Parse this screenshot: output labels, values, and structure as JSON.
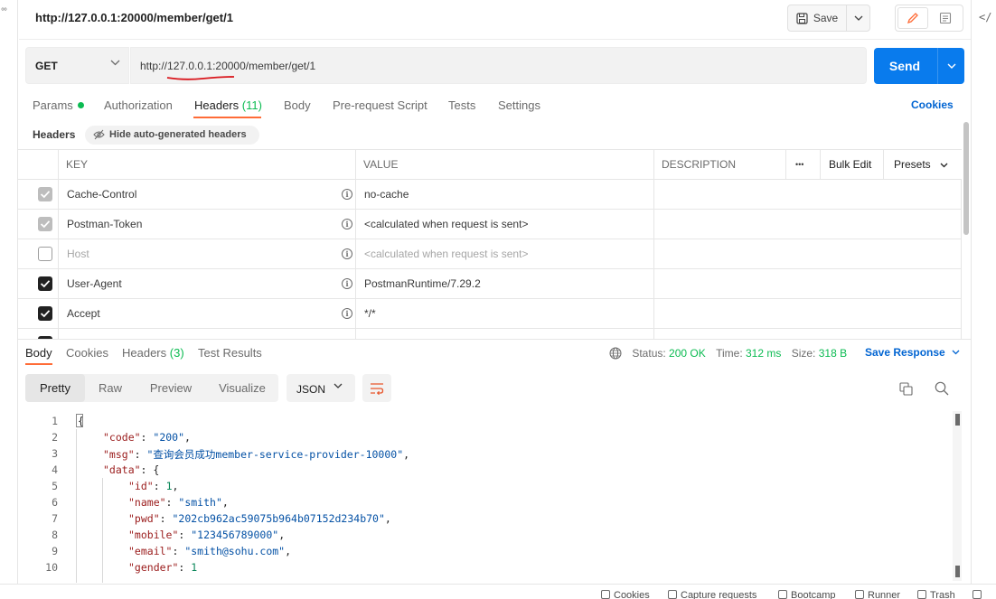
{
  "tab": {
    "title": "http://127.0.0.1:20000/member/get/1"
  },
  "toolbar": {
    "save_label": "Save"
  },
  "request": {
    "method": "GET",
    "url": "http://127.0.0.1:20000/member/get/1",
    "send_label": "Send"
  },
  "request_tabs": {
    "params": "Params",
    "authorization": "Authorization",
    "headers": "Headers",
    "headers_count": "(11)",
    "body": "Body",
    "prerequest": "Pre-request Script",
    "tests": "Tests",
    "settings": "Settings",
    "cookies": "Cookies"
  },
  "headers_section": {
    "label": "Headers",
    "hide_auto": "Hide auto-generated headers",
    "columns": {
      "key": "KEY",
      "value": "VALUE",
      "description": "DESCRIPTION",
      "more": "•••",
      "bulk_edit": "Bulk Edit",
      "presets": "Presets"
    },
    "rows": [
      {
        "key": "Cache-Control",
        "value": "no-cache",
        "state": "disabled-checked"
      },
      {
        "key": "Postman-Token",
        "value": "<calculated when request is sent>",
        "state": "disabled-checked"
      },
      {
        "key": "Host",
        "value": "<calculated when request is sent>",
        "state": "unchecked"
      },
      {
        "key": "User-Agent",
        "value": "PostmanRuntime/7.29.2",
        "state": "checked"
      },
      {
        "key": "Accept",
        "value": "*/*",
        "state": "checked"
      }
    ]
  },
  "response": {
    "tabs": {
      "body": "Body",
      "cookies": "Cookies",
      "headers": "Headers",
      "headers_count": "(3)",
      "test_results": "Test Results"
    },
    "status_label": "Status:",
    "status_value": "200 OK",
    "time_label": "Time:",
    "time_value": "312 ms",
    "size_label": "Size:",
    "size_value": "318 B",
    "save_response": "Save Response",
    "views": {
      "pretty": "Pretty",
      "raw": "Raw",
      "preview": "Preview",
      "visualize": "Visualize"
    },
    "format": "JSON",
    "line_numbers": [
      "1",
      "2",
      "3",
      "4",
      "5",
      "6",
      "7",
      "8",
      "9",
      "10"
    ],
    "code": {
      "l1": "{",
      "code_key": "\"code\"",
      "code_val": "\"200\"",
      "msg_key": "\"msg\"",
      "msg_val": "\"查询会员成功member-service-provider-10000\"",
      "data_key": "\"data\"",
      "data_open": "{",
      "id_key": "\"id\"",
      "id_val": "1",
      "name_key": "\"name\"",
      "name_val": "\"smith\"",
      "pwd_key": "\"pwd\"",
      "pwd_val": "\"202cb962ac59075b964b07152d234b70\"",
      "mobile_key": "\"mobile\"",
      "mobile_val": "\"123456789000\"",
      "email_key": "\"email\"",
      "email_val": "\"smith@sohu.com\"",
      "gender_key": "\"gender\"",
      "gender_val": "1"
    }
  },
  "status_bar": {
    "cookies": "Cookies",
    "capture": "Capture requests",
    "bootcamp": "Bootcamp",
    "runner": "Runner",
    "trash": "Trash"
  },
  "colors": {
    "accent": "#ff6c37",
    "send": "#097bed",
    "link": "#0265d2",
    "success": "#0cbb52"
  }
}
